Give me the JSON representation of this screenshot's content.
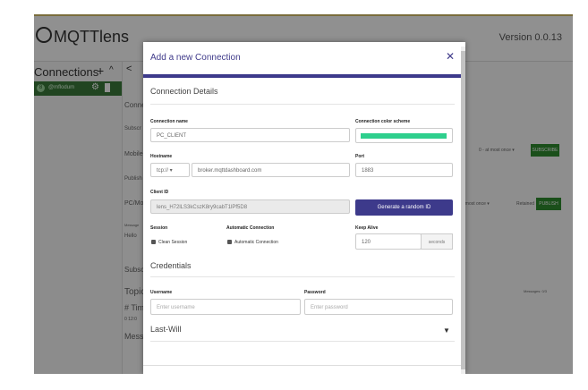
{
  "app": {
    "logo_text": "MQTTlens",
    "version": "Version 0.0.13"
  },
  "sidebar": {
    "title": "Connections",
    "add_glyph": "+",
    "collapse_glyph": "^",
    "connections": [
      {
        "badge": "8",
        "name": "@mflodum"
      }
    ]
  },
  "background": {
    "collapse_glyph": "<",
    "conne": "Conne",
    "subscr": "Subscr",
    "mobile": "Mobile",
    "publish": "Publish",
    "pc_mo": "PC/Mo",
    "message": "Message",
    "hello": "Hello",
    "subsc": "Subsc",
    "topic": "Topic",
    "hash_tim": "# Tim",
    "ts": "0 12:0",
    "mess": "Mess",
    "qos1": "0 - at most once ▾",
    "qos2": "t most once ▾",
    "retained": "Retained",
    "subscribe": "SUBSCRIBE",
    "publish_btn": "PUBLISH",
    "messages_badge": "Messages: 0/3"
  },
  "modal": {
    "title": "Add a new Connection",
    "close_glyph": "✕",
    "sections": {
      "details": "Connection Details",
      "credentials": "Credentials",
      "last_will": "Last-Will"
    },
    "labels": {
      "connection_name": "Connection name",
      "color_scheme": "Connection color scheme",
      "hostname": "Hostname",
      "port": "Port",
      "client_id": "Client ID",
      "session": "Session",
      "auto_conn": "Automatic Connection",
      "keep_alive": "Keep Alive",
      "username": "Username",
      "password": "Password"
    },
    "values": {
      "connection_name": "PC_CLIENT",
      "protocol": "tcp://",
      "hostname": "broker.mqttdashboard.com",
      "port": "1883",
      "client_id": "lens_H72lLS3kCszK8ry9cabT1lPf5D8",
      "keep_alive": "120",
      "keep_alive_unit": "seconds"
    },
    "placeholders": {
      "username": "Enter username",
      "password": "Enter password"
    },
    "checkboxes": {
      "clean_session": "Clean Session",
      "automatic_connection": "Automatic Connection"
    },
    "buttons": {
      "generate_id": "Generate a random ID"
    },
    "colors": {
      "accent": "#3d3a8b",
      "connection_color": "#2ecf8d"
    }
  }
}
